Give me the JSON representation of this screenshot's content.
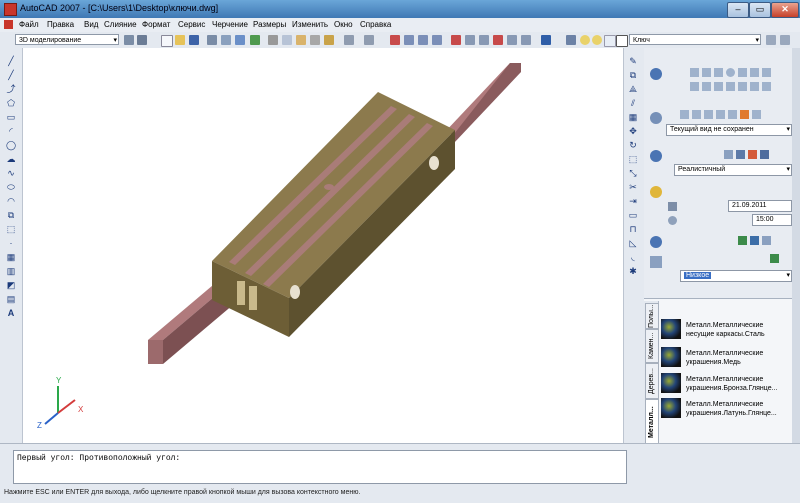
{
  "window": {
    "title": "AutoCAD 2007 - [C:\\Users\\1\\Desktop\\ключи.dwg]",
    "controls": {
      "minimize": "–",
      "maximize": "▭",
      "close": "✕"
    }
  },
  "menu": {
    "items": [
      "Файл",
      "Правка",
      "Вид",
      "Слияние",
      "Формат",
      "Сервис",
      "Черчение",
      "Размеры",
      "Изменить",
      "Окно",
      "Справка"
    ]
  },
  "toolbar": {
    "workspace": "3D моделирование",
    "layer": "Ключ"
  },
  "panel": {
    "view_combo": "Текущий вид не сохранен",
    "visual_style": "Реалистичный",
    "date": "21.09.2011",
    "time": "15:00",
    "quality": "Низкое",
    "accent": "#3a6fc4"
  },
  "palette": {
    "tabs": [
      "Металл...",
      "Дерев...",
      "Камен...",
      "Полы..."
    ],
    "materials": [
      "Металл.Металлические несущие каркасы.Сталь",
      "Металл.Металлические украшения.Медь",
      "Металл.Металлические украшения.Бронза.Глянце...",
      "Металл.Металлические украшения.Латунь.Глянце..."
    ]
  },
  "command": {
    "history": "Первый угол: Противоположный угол:"
  },
  "status": {
    "hint": "Нажмите ESC или ENTER для выхода, либо щелкните правой кнопкой мыши для вызова контекстного меню."
  },
  "ucs": {
    "x": "X",
    "y": "Y",
    "z": "Z"
  },
  "colors": {
    "block_top": "#8c7a4d",
    "block_front": "#6d5e36",
    "block_side": "#5d512f",
    "bar": "#b07a7c"
  }
}
